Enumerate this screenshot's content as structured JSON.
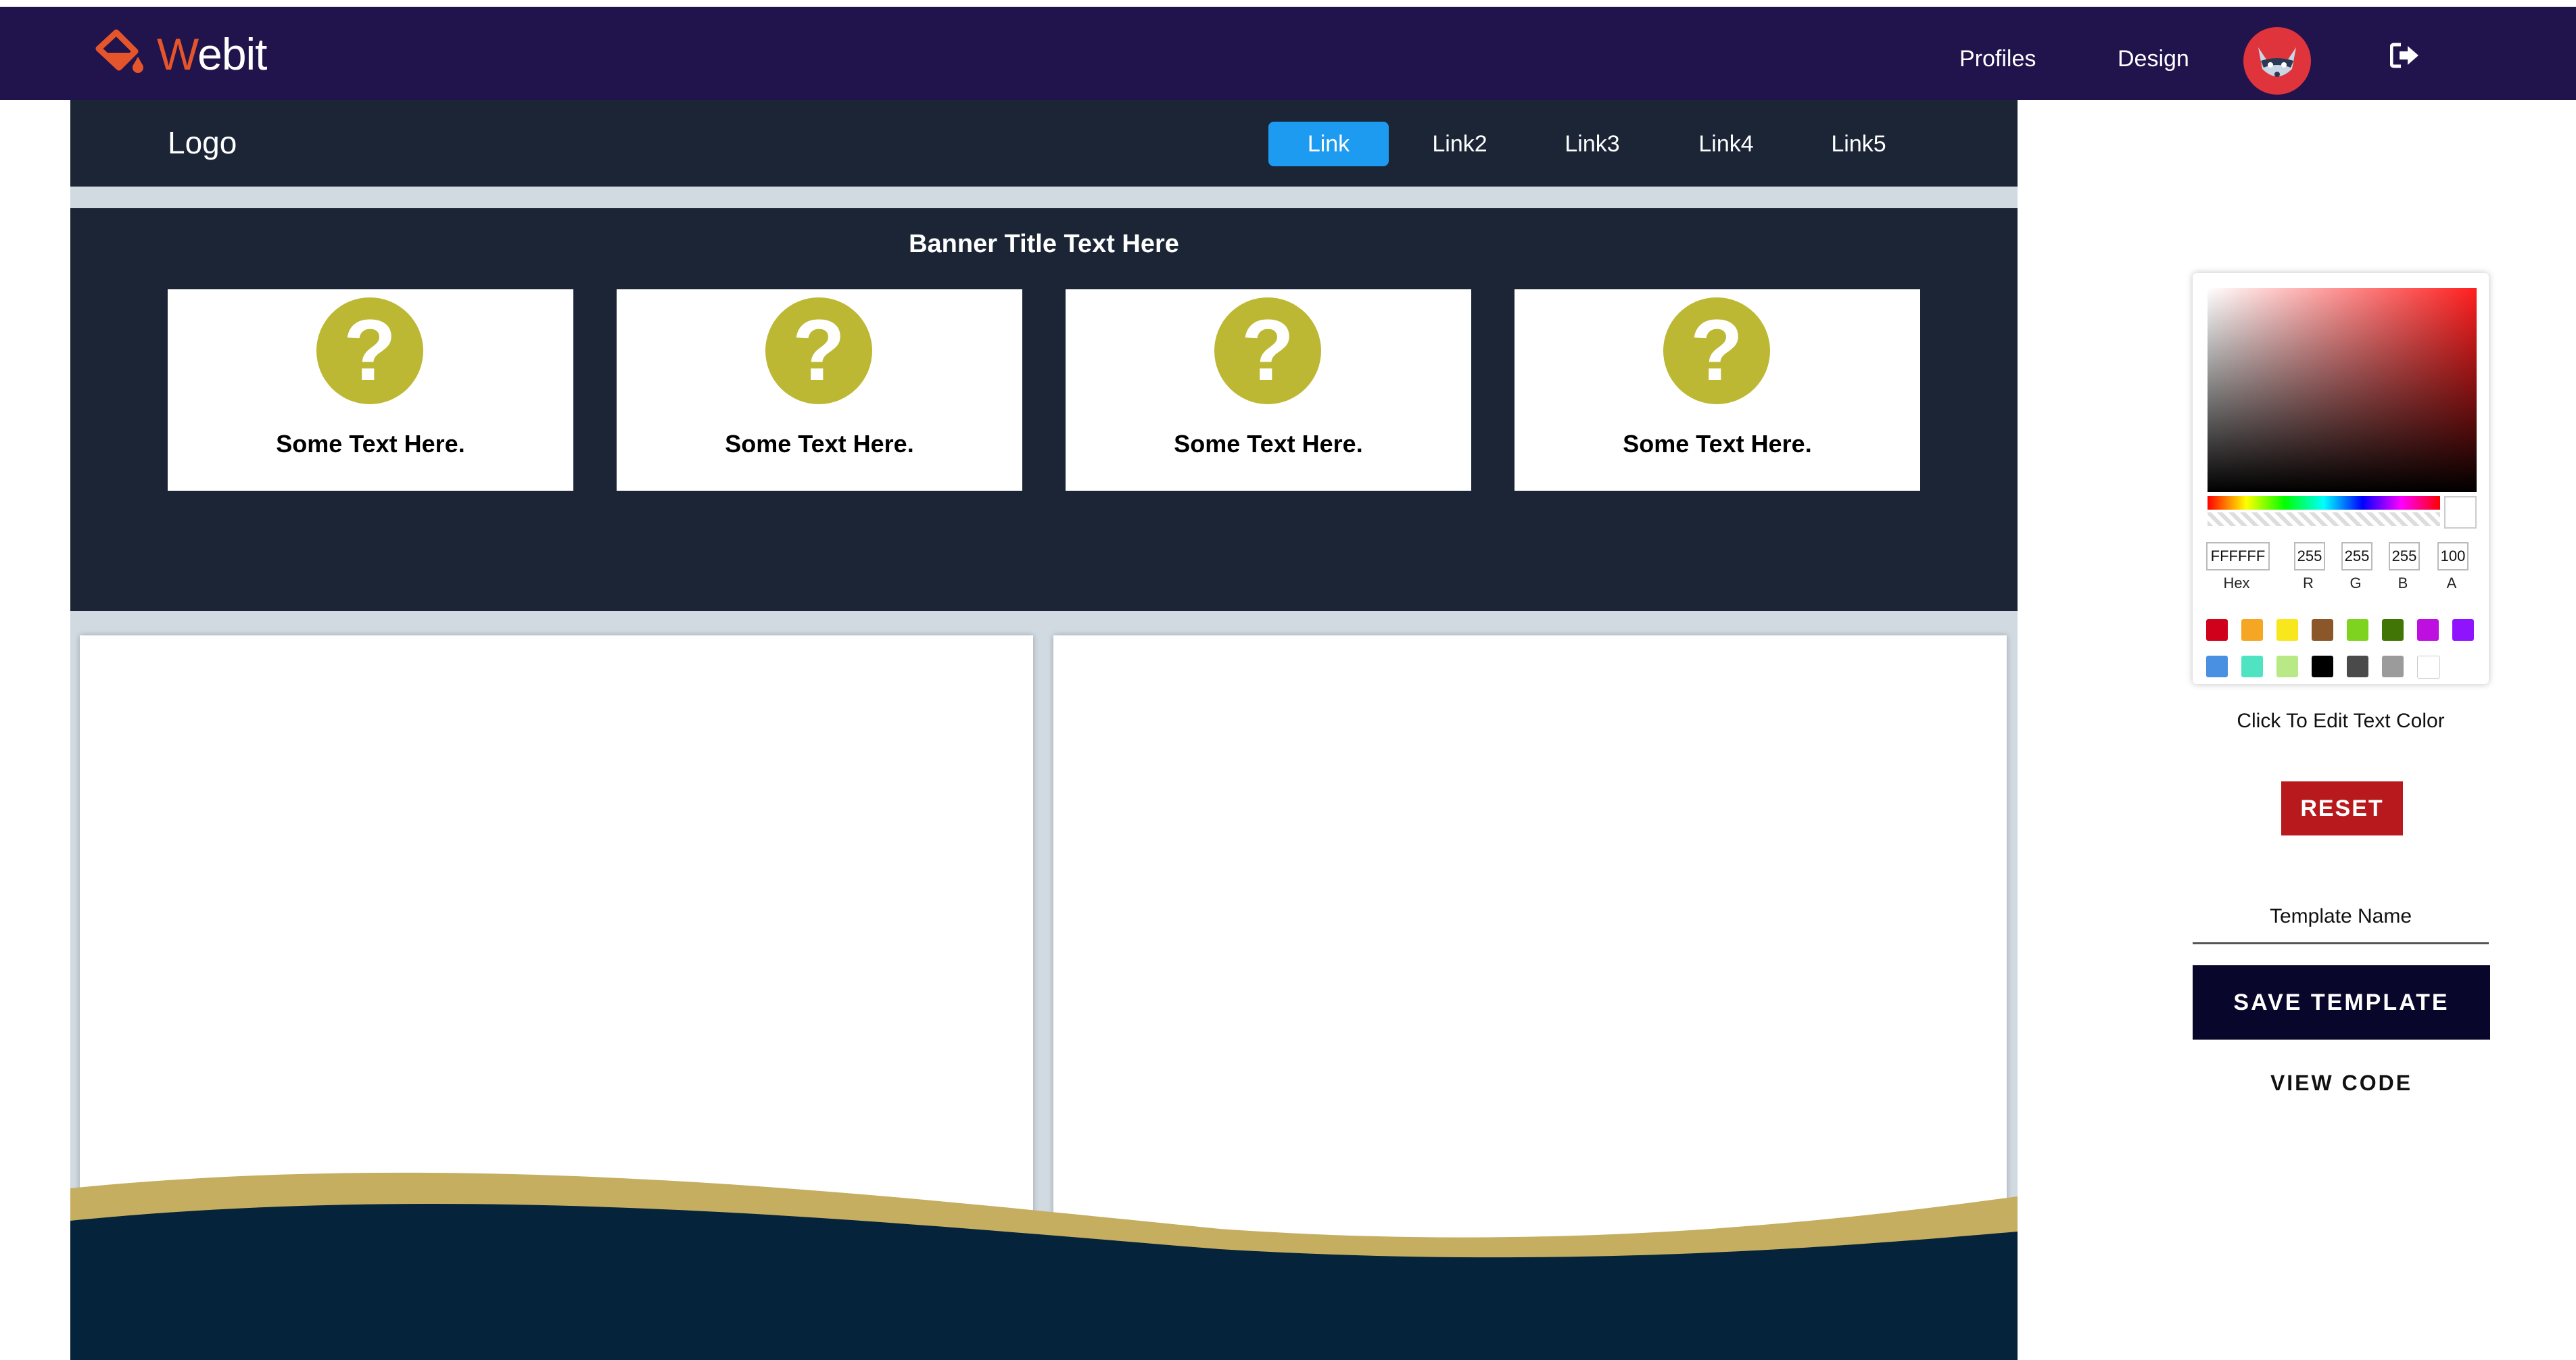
{
  "app": {
    "brand_first": "W",
    "brand_rest": "ebit",
    "nav": {
      "profiles": "Profiles",
      "design": "Design"
    }
  },
  "template": {
    "logo": "Logo",
    "links": [
      "Link",
      "Link2",
      "Link3",
      "Link4",
      "Link5"
    ],
    "active_link": "Link",
    "banner_title": "Banner Title Text Here",
    "cards": [
      "Some Text Here.",
      "Some Text Here.",
      "Some Text Here.",
      "Some Text Here."
    ],
    "colors": {
      "nav_bg": "#1b2536",
      "accent": "#1d9bf0",
      "icon": "#bdb833",
      "wave_gold": "#c5ae60",
      "footer": "#05233a"
    }
  },
  "color_picker": {
    "hex": "FFFFFF",
    "r": "255",
    "g": "255",
    "b": "255",
    "a": "100",
    "labels": {
      "hex": "Hex",
      "r": "R",
      "g": "G",
      "b": "B",
      "a": "A"
    },
    "swatches": [
      "#d0021b",
      "#f5a623",
      "#f8e71c",
      "#8b572a",
      "#7ed321",
      "#417505",
      "#bd10e0",
      "#9013fe",
      "#4a90e2",
      "#50e3c2",
      "#b8e986",
      "#000000",
      "#4a4a4a",
      "#9b9b9b",
      "#ffffff"
    ]
  },
  "sidebar": {
    "hint": "Click To Edit Text Color",
    "reset": "RESET",
    "template_name_placeholder": "Template Name",
    "save": "SAVE TEMPLATE",
    "view_code": "VIEW CODE"
  }
}
